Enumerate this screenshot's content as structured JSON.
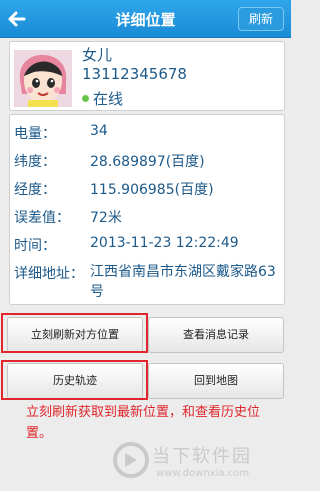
{
  "topbar": {
    "title": "详细位置",
    "refresh_label": "刷新"
  },
  "profile": {
    "name": "女儿",
    "phone": "13112345678",
    "status": "在线",
    "status_color": "#68c54a"
  },
  "info": {
    "battery_label": "电量：",
    "battery_value": "34",
    "lat_label": "纬度：",
    "lat_value": "28.689897(百度)",
    "lon_label": "经度：",
    "lon_value": "115.906985(百度)",
    "error_label": "误差值：",
    "error_value": "72米",
    "time_label": "时间：",
    "time_value": "2013-11-23 12:22:49",
    "address_label": "详细地址：",
    "address_value": "江西省南昌市东湖区戴家路63号"
  },
  "buttons": {
    "refresh_location": "立刻刷新对方位置",
    "view_messages": "查看消息记录",
    "history": "历史轨迹",
    "back_to_map": "回到地图"
  },
  "annotation": "立刻刷新获取到最新位置，和查看历史位置。",
  "watermark": {
    "brand": "当下软件园",
    "url": "www.downxia.com"
  },
  "colors": {
    "topbar": "#1a8bd6",
    "text": "#1d5a8a",
    "highlight": "#e0262c"
  },
  "icons": {
    "back": "arrow-left-icon",
    "avatar": "avatar-image",
    "watermark_logo": "downxia-logo"
  }
}
